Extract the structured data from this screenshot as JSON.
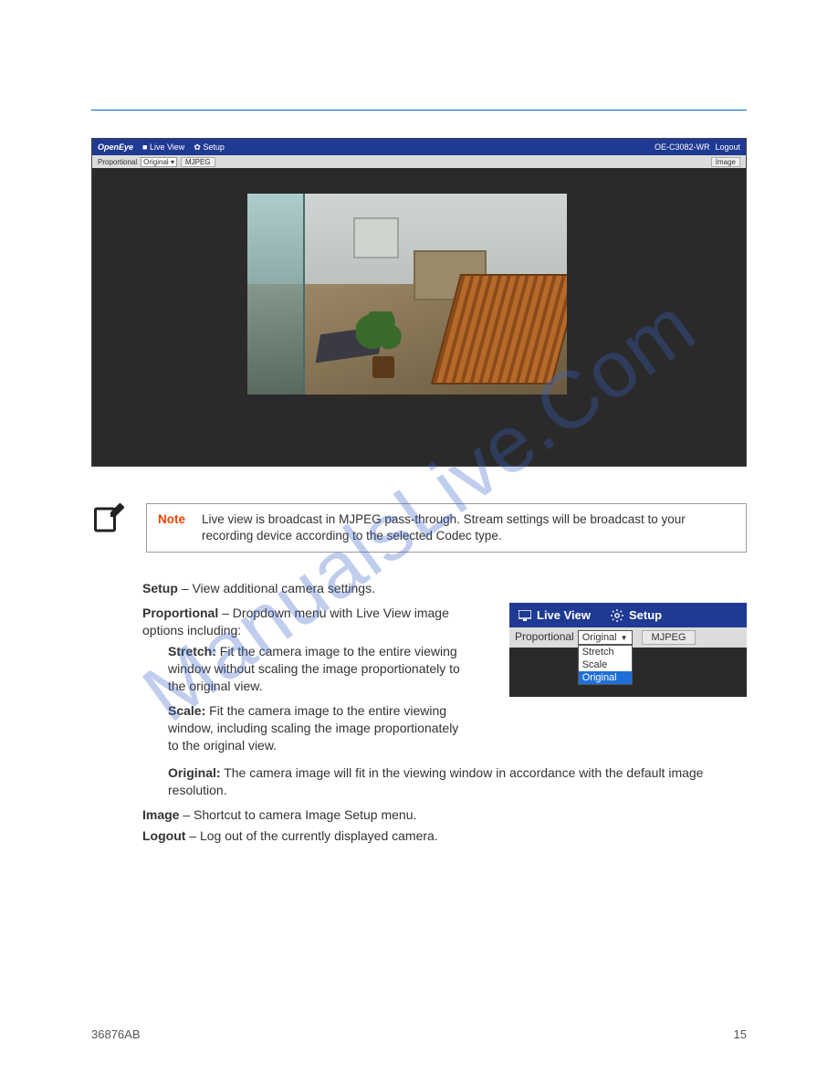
{
  "watermark": "ManualsLive.Com",
  "app_shot": {
    "brand": "OpenEye",
    "nav_live": "Live View",
    "nav_setup": "Setup",
    "model": "OE-C3082-WR",
    "logout": "Logout",
    "tb_proportional": "Proportional",
    "tb_select_value": "Original",
    "tb_mjpeg": "MJPEG",
    "tb_image": "Image"
  },
  "note": {
    "label": "Note",
    "text": "Live view is broadcast in MJPEG pass-through. Stream settings will be broadcast to your recording device according to the selected Codec type."
  },
  "body": {
    "setup_term": "Setup",
    "setup_text": " – View additional camera settings.",
    "prop_term": "Proportional",
    "prop_text": " – Dropdown menu with Live View image options including:",
    "stretch_term": "Stretch:",
    "stretch_text": " Fit the camera image to the entire viewing window without scaling the image proportionately to the original view.",
    "scale_term": "Scale:",
    "scale_text": " Fit the camera image to the entire viewing window, including scaling the image proportionately to the original view.",
    "original_term": "Original:",
    "original_text": " The camera image will fit in the viewing window in accordance with the default image resolution.",
    "image_term": "Image",
    "image_text": " – Shortcut to camera Image Setup menu.",
    "logout_term": "Logout",
    "logout_text": " – Log out of the currently displayed camera."
  },
  "inset": {
    "nav_live": "Live View",
    "nav_setup": "Setup",
    "proportional": "Proportional",
    "select_value": "Original",
    "mjpeg": "MJPEG",
    "options": {
      "stretch": "Stretch",
      "scale": "Scale",
      "original": "Original"
    }
  },
  "footer": {
    "doc_id": "36876AB",
    "page_num": "15"
  }
}
